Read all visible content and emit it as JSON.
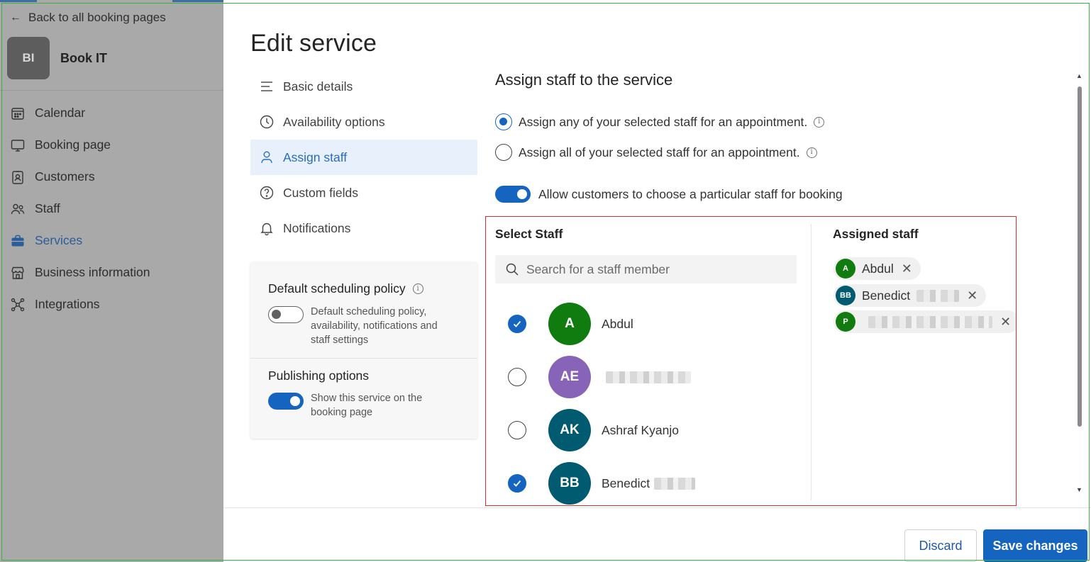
{
  "sidebar": {
    "back_label": "Back to all booking pages",
    "brand_initials": "BI",
    "brand_name": "Book IT",
    "items": [
      {
        "label": "Calendar",
        "icon": "calendar-icon",
        "active": false
      },
      {
        "label": "Booking page",
        "icon": "monitor-icon",
        "active": false
      },
      {
        "label": "Customers",
        "icon": "contact-card-icon",
        "active": false
      },
      {
        "label": "Staff",
        "icon": "people-icon",
        "active": false
      },
      {
        "label": "Services",
        "icon": "briefcase-icon",
        "active": true
      },
      {
        "label": "Business information",
        "icon": "storefront-icon",
        "active": false
      },
      {
        "label": "Integrations",
        "icon": "integrations-icon",
        "active": false
      }
    ]
  },
  "panel": {
    "title": "Edit service",
    "menu": [
      {
        "label": "Basic details",
        "icon": "text-lines-icon",
        "active": false
      },
      {
        "label": "Availability options",
        "icon": "clock-icon",
        "active": false
      },
      {
        "label": "Assign staff",
        "icon": "person-icon",
        "active": true
      },
      {
        "label": "Custom fields",
        "icon": "question-circle-icon",
        "active": false
      },
      {
        "label": "Notifications",
        "icon": "bell-icon",
        "active": false
      }
    ],
    "policy": {
      "title": "Default scheduling policy",
      "desc": "Default scheduling policy, availability, notifications and staff settings",
      "enabled": false
    },
    "publishing": {
      "title": "Publishing options",
      "desc": "Show this service on the booking page",
      "enabled": true
    }
  },
  "assign": {
    "title": "Assign staff to the service",
    "option_any": "Assign any of your selected staff for an appointment.",
    "option_all": "Assign all of your selected staff for an appointment.",
    "selected_option": "any",
    "allow_choose_label": "Allow customers to choose a particular staff for booking",
    "allow_choose": true,
    "select_staff_title": "Select Staff",
    "search_placeholder": "Search for a staff member",
    "staff": [
      {
        "initials": "A",
        "name": "Abdul",
        "color": "#107c10",
        "checked": true
      },
      {
        "initials": "AE",
        "name": "",
        "color": "#8764b8",
        "checked": false
      },
      {
        "initials": "AK",
        "name": "Ashraf Kyanjo",
        "color": "#005b70",
        "checked": false
      },
      {
        "initials": "BB",
        "name": "Benedict",
        "color": "#005b70",
        "checked": true
      }
    ],
    "assigned_title": "Assigned staff",
    "assigned": [
      {
        "initials": "A",
        "name": "Abdul",
        "color": "#107c10"
      },
      {
        "initials": "BB",
        "name": "Benedict",
        "color": "#005b70"
      },
      {
        "initials": "P",
        "name": "",
        "color": "#107c10"
      }
    ]
  },
  "footer": {
    "discard_label": "Discard",
    "save_label": "Save changes"
  },
  "colors": {
    "accent": "#1565c0",
    "highlight_box": "#d32f2f",
    "frame": "#3cb043"
  }
}
